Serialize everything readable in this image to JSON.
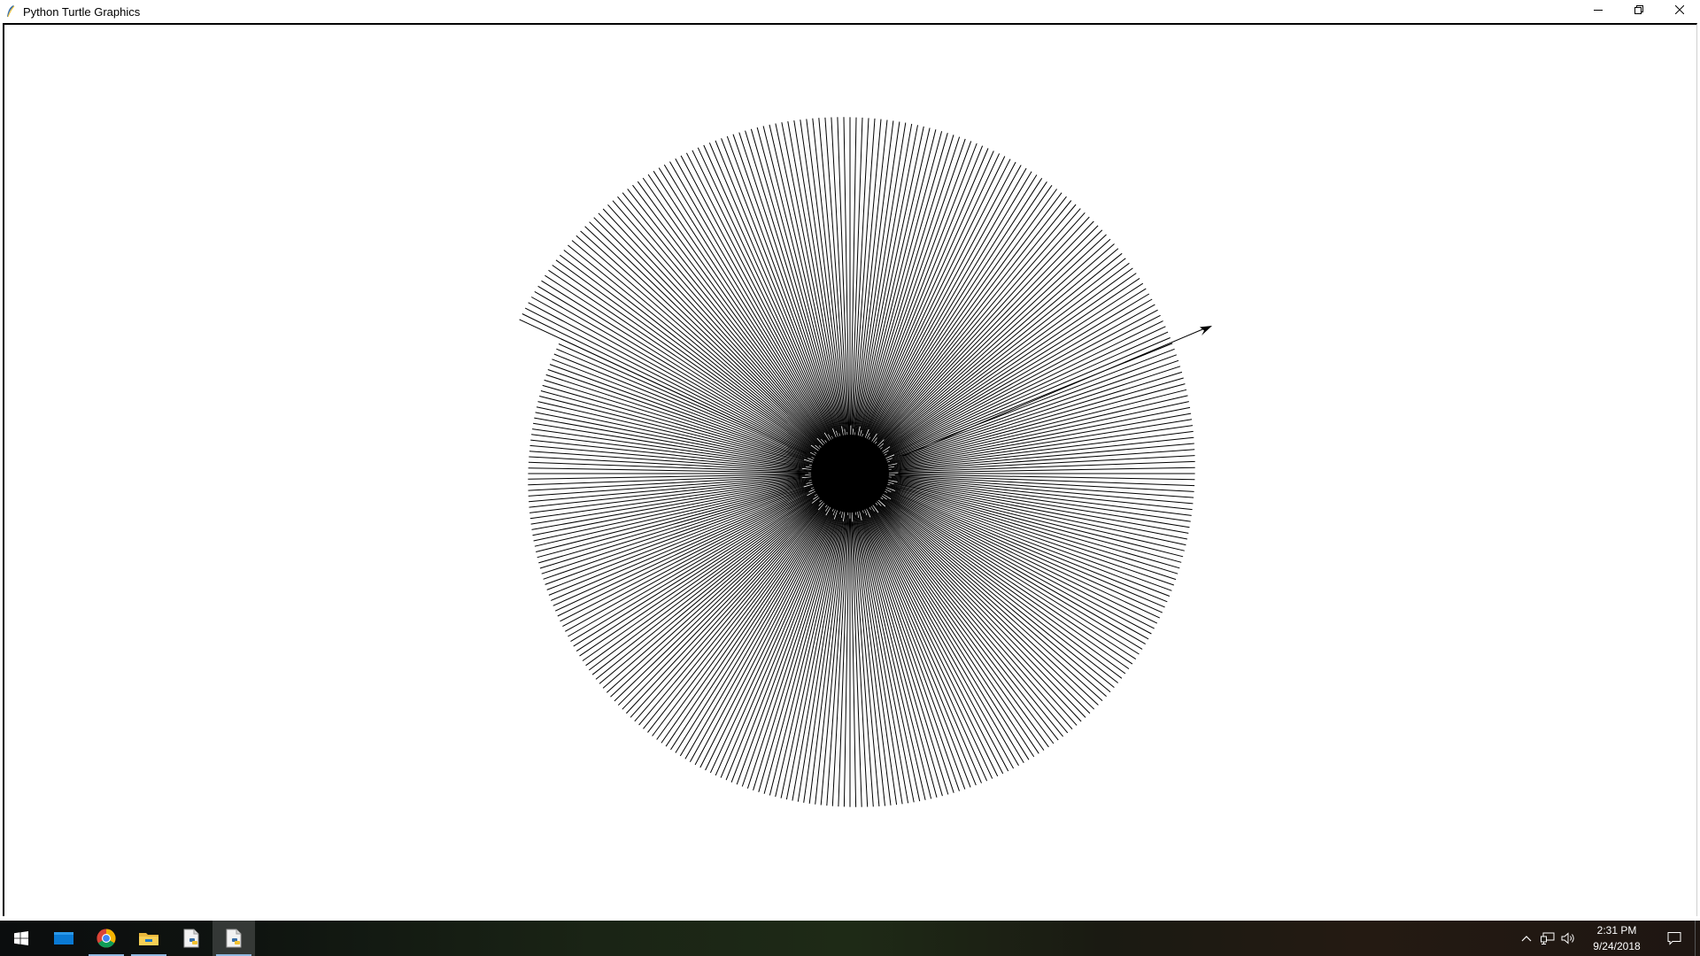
{
  "window": {
    "title": "Python Turtle Graphics",
    "icon": "python-feather-icon",
    "controls": [
      "minimize-icon",
      "restore-icon",
      "close-icon"
    ]
  },
  "canvas": {
    "background": "#ffffff",
    "stroke_color": "#000000",
    "drawing": "radial spiral of line segments (turtle graphics)",
    "turtle_cursor": "arrow-cursor-icon"
  },
  "taskbar": {
    "pinned": [
      {
        "name": "start-button",
        "icon": "windows-logo-icon",
        "active": false,
        "running": false
      },
      {
        "name": "taskbar-mail",
        "icon": "mail-icon",
        "active": false,
        "running": false
      },
      {
        "name": "taskbar-chrome",
        "icon": "chrome-icon",
        "active": false,
        "running": true
      },
      {
        "name": "taskbar-file-explorer",
        "icon": "folder-icon",
        "active": false,
        "running": true
      },
      {
        "name": "taskbar-python-idle",
        "icon": "python-file-icon",
        "active": false,
        "running": false
      },
      {
        "name": "taskbar-python-turtle",
        "icon": "python-file-icon",
        "active": true,
        "running": true
      }
    ],
    "tray": {
      "icons": [
        "chevron-up-icon",
        "network-icon",
        "volume-icon"
      ],
      "time": "2:31 PM",
      "date": "9/24/2018",
      "notifications_icon": "action-center-icon"
    },
    "accent": "#8fb8e0"
  }
}
